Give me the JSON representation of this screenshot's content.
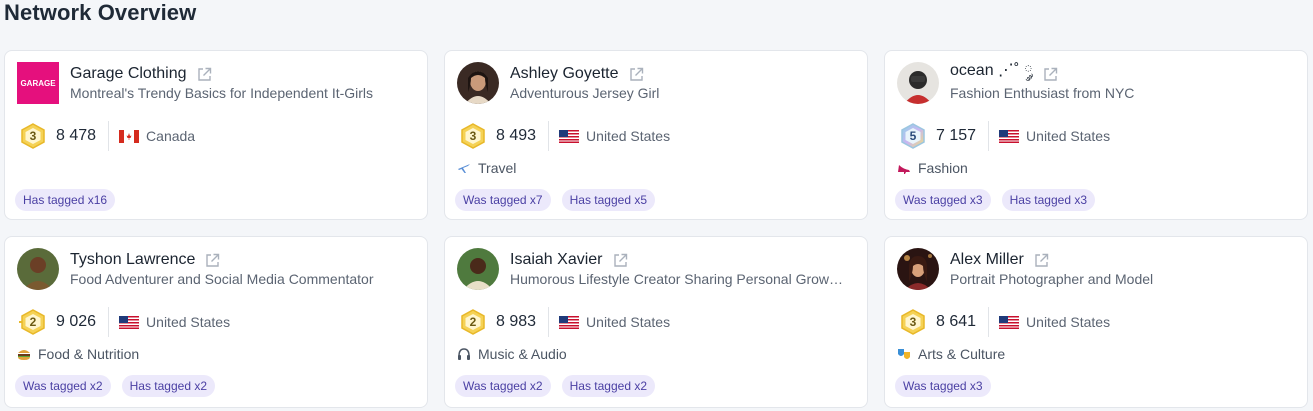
{
  "page_title": "Network Overview",
  "accent_tag_bg": "#ece9fb",
  "accent_tag_text": "#4a3fa3",
  "cards": [
    {
      "name": "Garage Clothing",
      "bio": "Montreal's Trendy Basics for Independent It-Girls",
      "avatar_text": "GARAGE",
      "avatar_icon": "brand-logo",
      "level": "3",
      "followers": "8 478",
      "country": "Canada",
      "flag_icon": "canada-flag-icon",
      "category": "",
      "category_icon": "",
      "tags": [
        "Has tagged x16"
      ]
    },
    {
      "name": "Ashley Goyette",
      "bio": "Adventurous Jersey Girl",
      "avatar_icon": "user-photo",
      "level": "3",
      "followers": "8 493",
      "country": "United States",
      "flag_icon": "us-flag-icon",
      "category": "Travel",
      "category_icon": "airplane-icon",
      "tags": [
        "Was tagged x7",
        "Has tagged x5"
      ]
    },
    {
      "name": "ocean ⋰˚ ༘",
      "bio": "Fashion Enthusiast from NYC",
      "avatar_icon": "user-photo",
      "level": "5",
      "followers": "7 157",
      "country": "United States",
      "flag_icon": "us-flag-icon",
      "category": "Fashion",
      "category_icon": "high-heel-icon",
      "tags": [
        "Was tagged x3",
        "Has tagged x3"
      ]
    },
    {
      "name": "Tyshon Lawrence",
      "bio": "Food Adventurer and Social Media Commentator",
      "avatar_icon": "user-photo",
      "level": "2",
      "followers": "9 026",
      "country": "United States",
      "flag_icon": "us-flag-icon",
      "category": "Food & Nutrition",
      "category_icon": "burger-icon",
      "tags": [
        "Was tagged x2",
        "Has tagged x2"
      ]
    },
    {
      "name": "Isaiah Xavier",
      "bio": "Humorous Lifestyle Creator Sharing Personal Grow…",
      "avatar_icon": "user-photo",
      "level": "2",
      "followers": "8 983",
      "country": "United States",
      "flag_icon": "us-flag-icon",
      "category": "Music & Audio",
      "category_icon": "headphones-icon",
      "tags": [
        "Was tagged x2",
        "Has tagged x2"
      ]
    },
    {
      "name": "Alex Miller",
      "bio": "Portrait Photographer and Model",
      "avatar_icon": "user-photo",
      "level": "3",
      "followers": "8 641",
      "country": "United States",
      "flag_icon": "us-flag-icon",
      "category": "Arts & Culture",
      "category_icon": "theater-masks-icon",
      "tags": [
        "Was tagged x3"
      ]
    }
  ]
}
